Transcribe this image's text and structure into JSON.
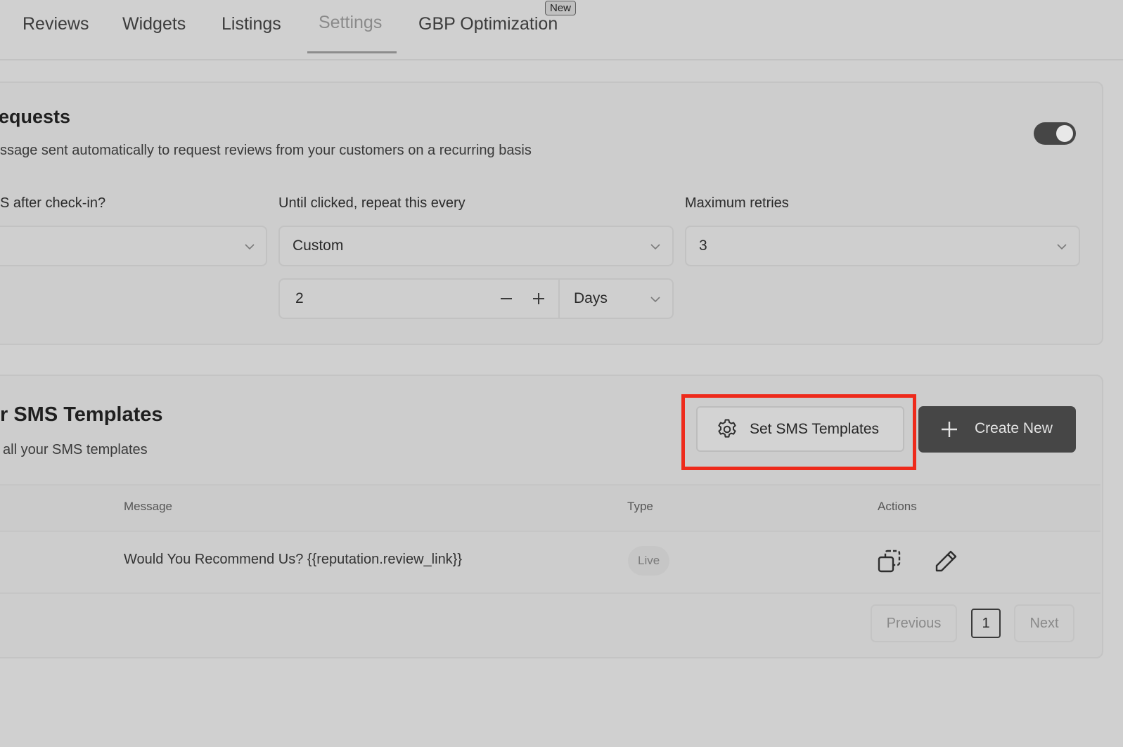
{
  "tabs": {
    "reviews": "Reviews",
    "widgets": "Widgets",
    "listings": "Listings",
    "settings": "Settings",
    "gbp": "GBP Optimization",
    "new_badge": "New"
  },
  "requests_card": {
    "title": "equests",
    "subtitle": "ssage sent automatically to request reviews from your customers on a recurring basis",
    "enabled": true,
    "field1_label": "S after check-in?",
    "field1_value": "",
    "field2_label": "Until clicked, repeat this every",
    "field2_value": "Custom",
    "field3_label": "Maximum retries",
    "field3_value": "3",
    "interval_value": "2",
    "interval_unit": "Days"
  },
  "templates_card": {
    "title": "r SMS Templates",
    "subtitle": "all your SMS templates",
    "set_button": "Set SMS Templates",
    "create_button": "Create New"
  },
  "table": {
    "headers": {
      "message": "Message",
      "type": "Type",
      "actions": "Actions"
    },
    "rows": [
      {
        "message": "Would You Recommend Us? {{reputation.review_link}}",
        "type": "Live",
        "actions": [
          "copy-icon",
          "edit-icon"
        ]
      }
    ]
  },
  "pagination": {
    "previous": "Previous",
    "page": "1",
    "next": "Next"
  },
  "colors": {
    "highlight": "#ee2a1b",
    "dark_button": "#464646"
  }
}
